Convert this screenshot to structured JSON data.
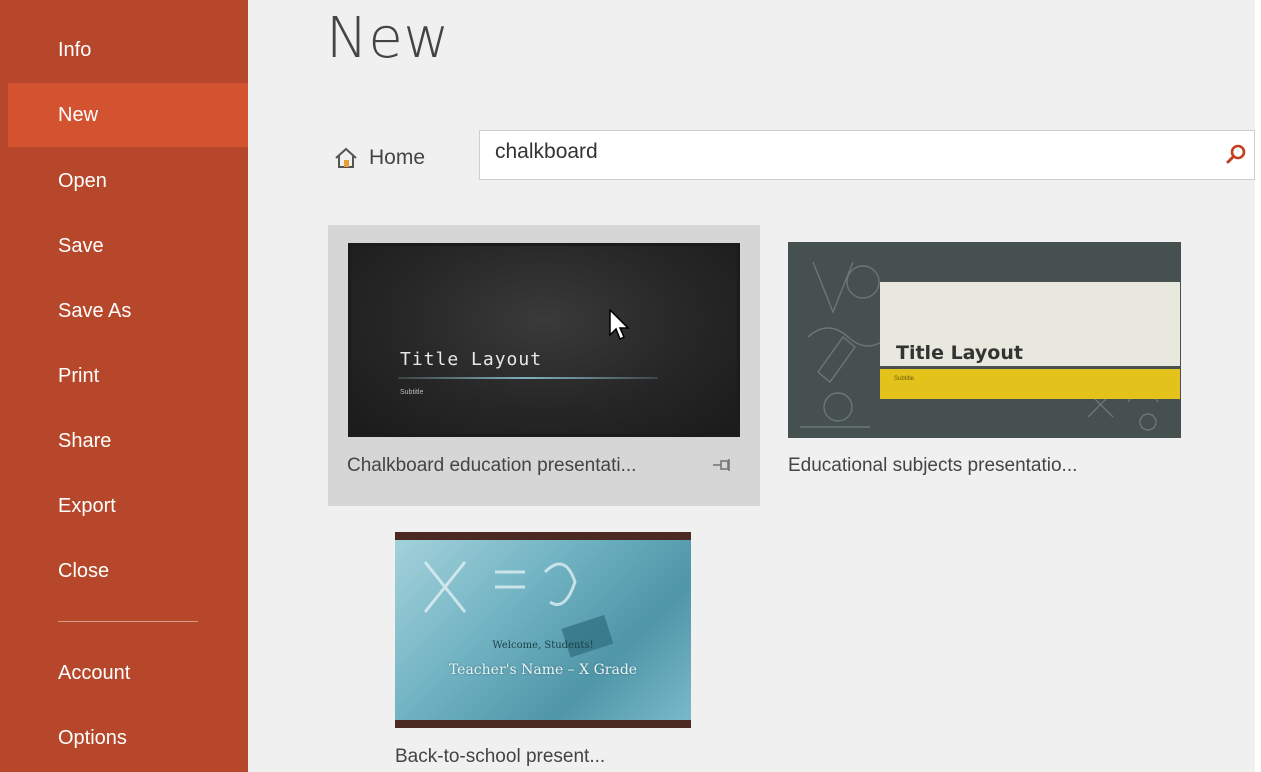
{
  "sidebar": {
    "items": [
      {
        "label": "Info"
      },
      {
        "label": "New",
        "active": true
      },
      {
        "label": "Open"
      },
      {
        "label": "Save"
      },
      {
        "label": "Save As"
      },
      {
        "label": "Print"
      },
      {
        "label": "Share"
      },
      {
        "label": "Export"
      },
      {
        "label": "Close"
      }
    ],
    "bottom_items": [
      {
        "label": "Account"
      },
      {
        "label": "Options"
      }
    ]
  },
  "main": {
    "title": "New",
    "home_label": "Home",
    "search": {
      "value": "chalkboard"
    },
    "templates": [
      {
        "name": "Chalkboard education presentati...",
        "preview_title": "Title Layout",
        "preview_subtitle": "Subtitle",
        "selected": true,
        "pin_icon": "pin-icon"
      },
      {
        "name": "Educational subjects presentatio...",
        "preview_title": "Title Layout",
        "preview_subtitle": "Subtitle"
      },
      {
        "name": "Back-to-school present...",
        "preview_title": "Welcome, Students!",
        "preview_subtitle": "Teacher's Name – X Grade"
      }
    ]
  },
  "colors": {
    "sidebar_bg": "#b7472a",
    "sidebar_active": "#d35230",
    "main_bg": "#f0f0f0",
    "search_accent": "#c43e1c"
  }
}
